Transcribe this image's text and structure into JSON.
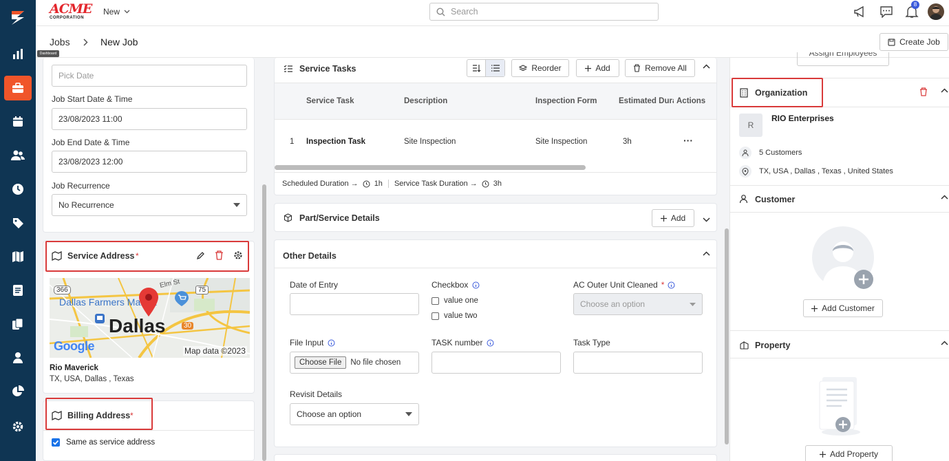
{
  "app": {
    "logo_text": "ACME",
    "logo_sub": "CORPORATION",
    "new_label": "New",
    "search_placeholder": "Search",
    "notif_count": "8"
  },
  "nav": {
    "icons": [
      "logo-icon",
      "chart-icon",
      "briefcase-icon",
      "calendar-icon",
      "users-icon",
      "clock-icon",
      "tag-icon",
      "map-icon",
      "document-icon",
      "copy-icon",
      "person-icon",
      "pie-icon",
      "gear-icon"
    ],
    "tooltip": "Dashboard"
  },
  "breadcrumb": {
    "parent": "Jobs",
    "current": "New Job"
  },
  "create_job": "Create Job",
  "left": {
    "pick_date": "Pick Date",
    "start_label": "Job Start Date & Time",
    "start_value": "23/08/2023 11:00",
    "end_label": "Job End Date & Time",
    "end_value": "23/08/2023 12:00",
    "recur_label": "Job Recurrence",
    "recur_value": "No Recurrence",
    "service_address": "Service Address",
    "required": "*",
    "map": {
      "city": "Dallas",
      "market": "Dallas Farmers Market",
      "street": "Elm St",
      "r366": "366",
      "r75": "75",
      "r30": "30",
      "google": "Google",
      "mapdata": "Map data ©2023"
    },
    "addr_name": "Rio Maverick",
    "addr_line": "TX, USA, Dallas , Texas",
    "billing_address": "Billing Address",
    "same_as": "Same as service address"
  },
  "tasks": {
    "title": "Service Tasks",
    "reorder": "Reorder",
    "add": "Add",
    "remove_all": "Remove All",
    "columns": [
      "Service Task",
      "Description",
      "Inspection Form",
      "Estimated Duration",
      "Actions"
    ],
    "rows": [
      {
        "num": "1",
        "task": "Inspection Task",
        "desc": "Site Inspection",
        "form": "Site Inspection",
        "dur": "3h",
        "actions": "···"
      }
    ],
    "sched_label": "Scheduled Duration →",
    "sched_val": "1h",
    "std_label": "Service Task Duration →",
    "std_val": "3h"
  },
  "parts": {
    "title": "Part/Service Details",
    "add": "Add"
  },
  "other": {
    "title": "Other Details",
    "date_entry": "Date of Entry",
    "checkbox": "Checkbox",
    "opt1": "value one",
    "opt2": "value two",
    "ac": "AC Outer Unit Cleaned",
    "choose": "Choose an option",
    "file_input": "File Input",
    "choose_file": "Choose File",
    "no_file": "No file chosen",
    "task_number": "TASK number",
    "task_type": "Task Type",
    "revisit": "Revisit Details",
    "revisit_value": "Choose an option"
  },
  "right": {
    "assign": "Assign Employees",
    "org_title": "Organization",
    "org_initial": "R",
    "org_name": "RIO Enterprises",
    "org_customers": "5 Customers",
    "org_addr": "TX, USA , Dallas , Texas , United States",
    "customer_title": "Customer",
    "add_customer": "Add Customer",
    "property_title": "Property",
    "add_property": "Add Property"
  },
  "colors": {
    "nav": "#0f3553",
    "accent": "#f0552a",
    "red": "#d93a3a",
    "blue": "#1a73e8"
  }
}
